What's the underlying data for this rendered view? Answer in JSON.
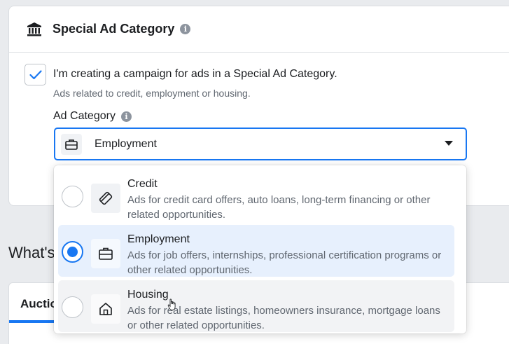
{
  "section": {
    "title": "Special Ad Category",
    "checkbox_label": "I'm creating a campaign for ads in a Special Ad Category.",
    "checkbox_sublabel": "Ads related to credit, employment or housing.",
    "checkbox_checked": true,
    "field_label": "Ad Category",
    "selected_value": "Employment"
  },
  "dropdown": {
    "options": [
      {
        "title": "Credit",
        "description": "Ads for credit card offers, auto loans, long-term financing or other related opportunities.",
        "icon": "credit-card-icon",
        "selected": false
      },
      {
        "title": "Employment",
        "description": "Ads for job offers, internships, professional certification programs or other related opportunities.",
        "icon": "briefcase-icon",
        "selected": true
      },
      {
        "title": "Housing",
        "description": "Ads for real estate listings, homeowners insurance, mortgage loans or other related opportunities.",
        "icon": "house-icon",
        "selected": false
      }
    ]
  },
  "background": {
    "heading_partial": "What's",
    "tab_partial": "Auctio"
  },
  "colors": {
    "accent": "#1877f2",
    "selected_bg": "#e7f0fd",
    "hover_bg": "#f2f3f5",
    "muted_text": "#606770"
  }
}
